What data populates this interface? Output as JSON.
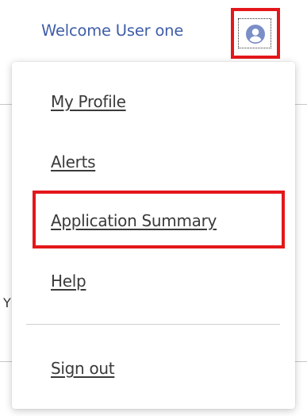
{
  "header": {
    "welcome_text": "Welcome User one",
    "user_icon": "user-circle-icon"
  },
  "menu": {
    "items": [
      {
        "label": "My Profile"
      },
      {
        "label": "Alerts"
      },
      {
        "label": "Application Summary"
      },
      {
        "label": "Help"
      },
      {
        "label": "Sign out"
      }
    ]
  },
  "background": {
    "partial_text": "Y"
  },
  "colors": {
    "welcome_text": "#3f5da8",
    "user_icon": "#7a8ec7",
    "highlight": "#e3171a",
    "menu_text": "#3a3a3a"
  }
}
